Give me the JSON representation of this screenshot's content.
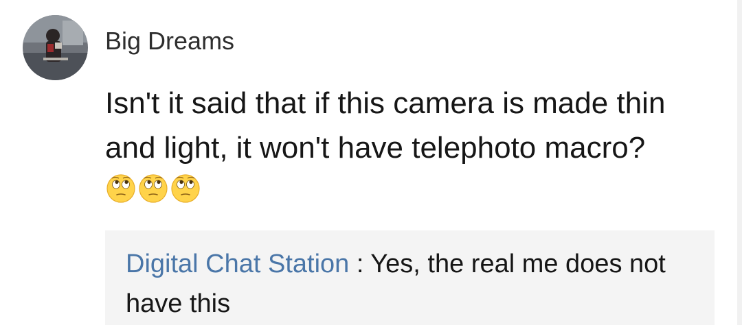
{
  "comment": {
    "author": "Big Dreams",
    "text": "Isn't it said that if this camera is made thin and light, it won't have telephoto macro?",
    "emoji_icons": [
      "face-with-rolling-eyes-icon",
      "face-with-rolling-eyes-icon",
      "face-with-rolling-eyes-icon"
    ]
  },
  "reply": {
    "author": "Digital Chat Station",
    "separator": " : ",
    "text": "Yes, the real me does not have this"
  },
  "colors": {
    "reply_author": "#4a76a8",
    "reply_background": "#f4f4f4",
    "text": "#161616"
  }
}
